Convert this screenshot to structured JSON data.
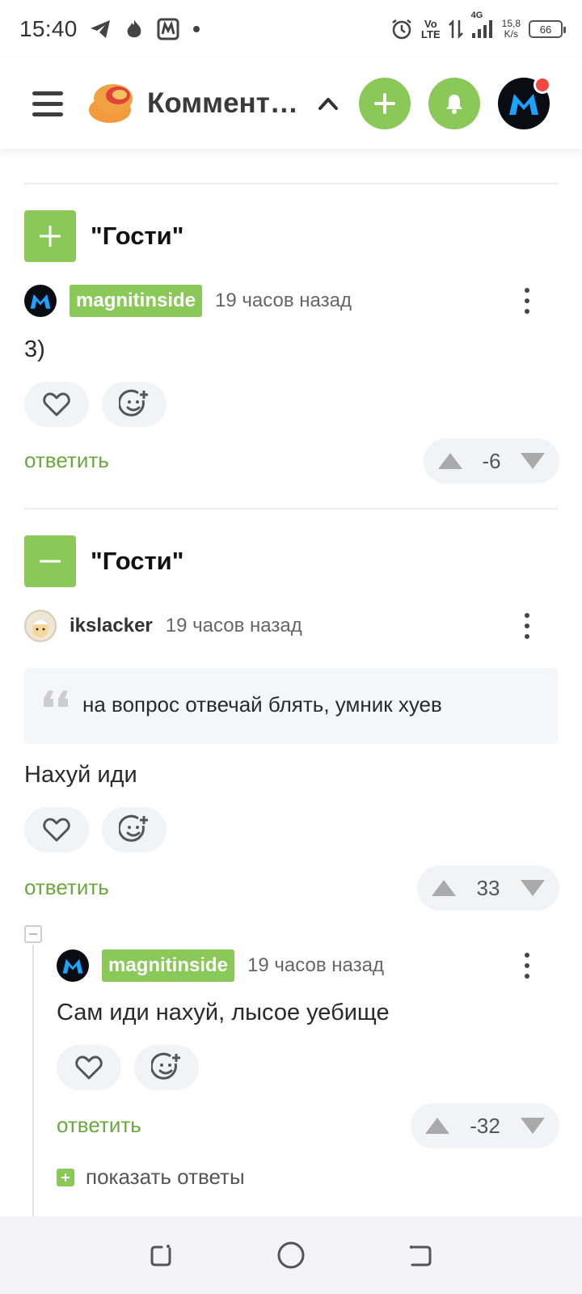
{
  "status_bar": {
    "time": "15:40",
    "network_speed": [
      "15,8",
      "K/s"
    ],
    "volte": [
      "Vo",
      "LTE"
    ],
    "network_type": "4G",
    "battery": "66"
  },
  "header": {
    "title": "Комментарии",
    "icons": [
      "menu-icon",
      "logo",
      "chevron-up-icon",
      "plus-icon",
      "bell-icon",
      "avatar"
    ]
  },
  "threads": [
    {
      "title": "\"Гости\"",
      "expanded": false,
      "comment": {
        "author": "magnitinside",
        "time": "19 часов назад",
        "text": "3)",
        "reply_label": "ответить",
        "rating": "-6"
      }
    },
    {
      "title": "\"Гости\"",
      "expanded": true,
      "comment": {
        "author": "ikslacker",
        "time": "19 часов назад",
        "quote": "на вопрос отвечай блять, умник хуев",
        "text": "Нахуй иди",
        "reply_label": "ответить",
        "rating": "33"
      },
      "reply": {
        "author": "magnitinside",
        "time": "19 часов назад",
        "text": "Сам иди нахуй, лысое уебище",
        "reply_label": "ответить",
        "rating": "-32",
        "show_replies_label": "показать ответы"
      }
    }
  ],
  "colors": {
    "accent_green": "#8ac858",
    "link_green": "#6aa83e",
    "notification_red": "#f0483e"
  }
}
